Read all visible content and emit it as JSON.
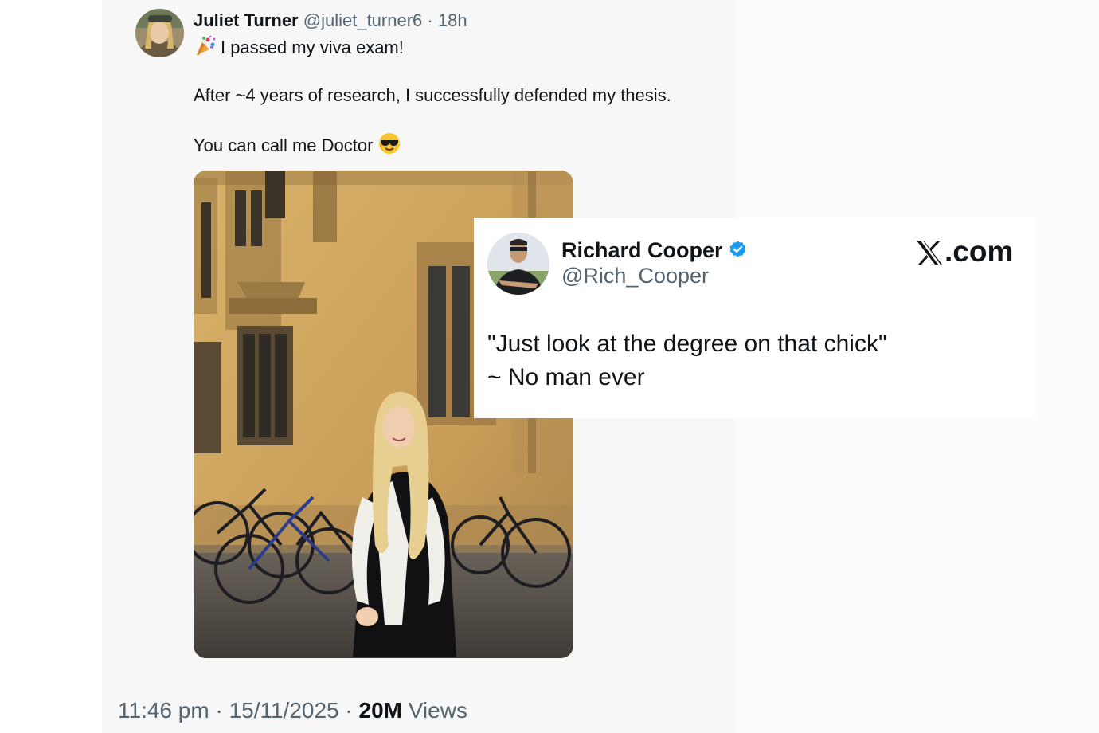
{
  "tweet": {
    "author": {
      "display_name": "Juliet Turner",
      "handle": "@juliet_turner6",
      "time_ago": "18h"
    },
    "separator": "·",
    "lines": [
      "I passed my viva exam!",
      "After ~4 years of research, I successfully defended my thesis.",
      "You can call me Doctor"
    ],
    "emojis": {
      "line1": "confetti-icon",
      "line3": "sunglasses-face-icon"
    },
    "media": {
      "type": "photo",
      "subject": "woman in academic gown in front of stone building with bicycles"
    },
    "footer": {
      "time": "11:46 pm",
      "date": "15/11/2025",
      "views_count": "20M",
      "views_label": "Views"
    }
  },
  "reply_card": {
    "author": {
      "display_name": "Richard Cooper",
      "handle": "@Rich_Cooper",
      "verified": true
    },
    "brand": {
      "x_letter": "X",
      "suffix": ".com"
    },
    "lines": [
      "\"Just look at the degree on that chick\"",
      "~ No man ever"
    ]
  },
  "colors": {
    "text_primary": "#0f1419",
    "text_secondary": "#536471",
    "verified_blue": "#1d9bf0",
    "main_background": "#f7f7f7"
  }
}
